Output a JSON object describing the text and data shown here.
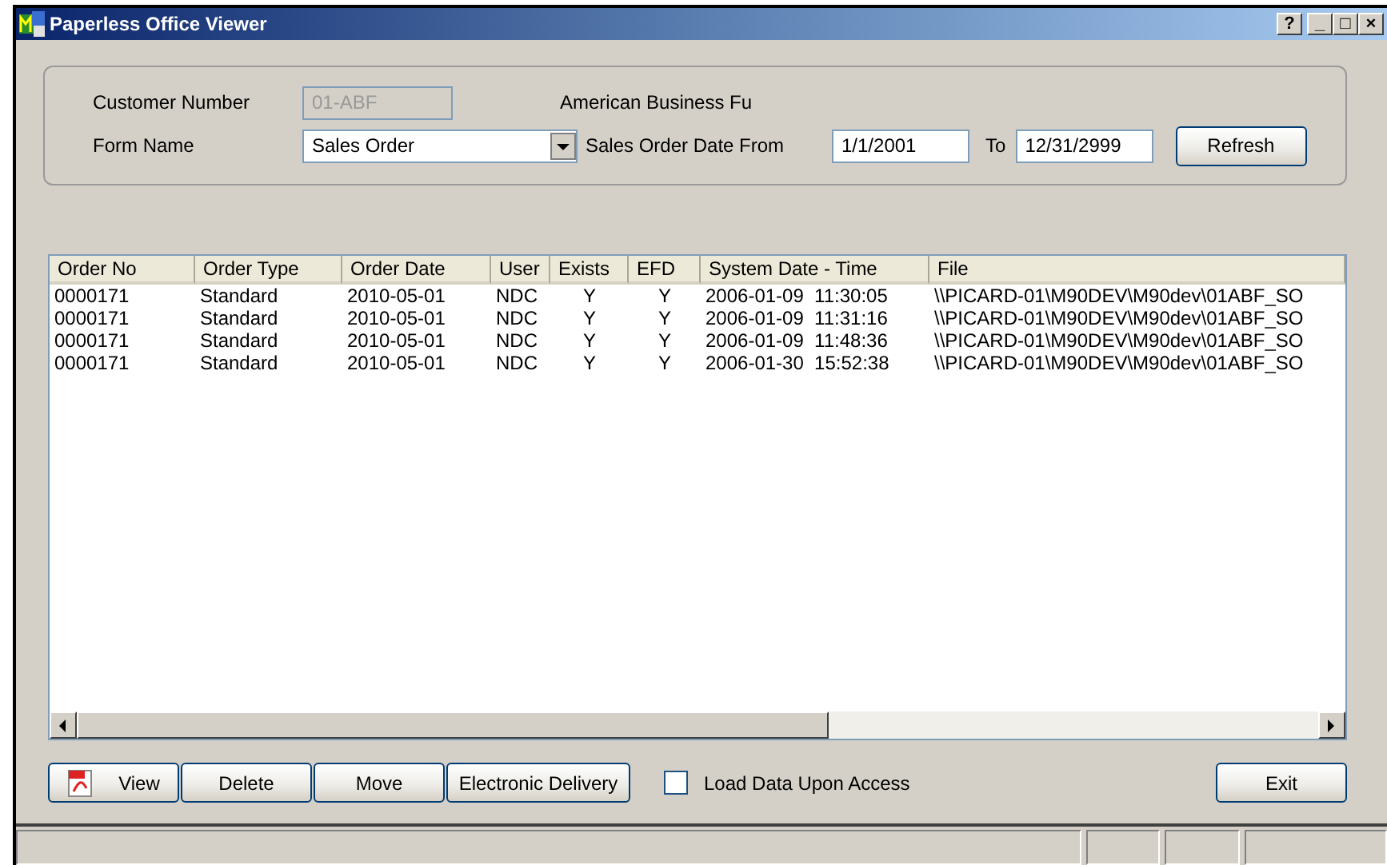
{
  "window": {
    "title": "Paperless Office Viewer",
    "title_buttons": [
      "?",
      "_",
      "□",
      "×"
    ]
  },
  "filters": {
    "customer_number": {
      "label": "Customer Number",
      "value": "01-ABF",
      "disabled": true
    },
    "customer_name": "American Business Fu",
    "form_name": {
      "label": "Form Name",
      "value": "Sales Order"
    },
    "date_from": {
      "label": "Sales Order Date From",
      "value": "1/1/2001"
    },
    "date_to": {
      "label": "To",
      "value": "12/31/2999"
    },
    "refresh_button": "Refresh"
  },
  "table": {
    "columns": [
      "Order No",
      "Order Type",
      "Order Date",
      "User",
      "Exists",
      "EFD",
      "System Date - Time",
      "File"
    ],
    "rows": [
      [
        "0000171",
        "Standard",
        "2010-05-01",
        "NDC",
        "Y",
        "Y",
        "2006-01-09  11:30:05",
        "\\\\PICARD-01\\M90DEV\\M90dev\\01ABF_SO"
      ],
      [
        "0000171",
        "Standard",
        "2010-05-01",
        "NDC",
        "Y",
        "Y",
        "2006-01-09  11:31:16",
        "\\\\PICARD-01\\M90DEV\\M90dev\\01ABF_SO"
      ],
      [
        "0000171",
        "Standard",
        "2010-05-01",
        "NDC",
        "Y",
        "Y",
        "2006-01-09  11:48:36",
        "\\\\PICARD-01\\M90DEV\\M90dev\\01ABF_SO"
      ],
      [
        "0000171",
        "Standard",
        "2010-05-01",
        "NDC",
        "Y",
        "Y",
        "2006-01-30  15:52:38",
        "\\\\PICARD-01\\M90DEV\\M90dev\\01ABF_SO"
      ]
    ]
  },
  "actions": [
    {
      "label": "View",
      "kind": "pdf"
    },
    {
      "label": "Delete",
      "kind": "plain"
    },
    {
      "label": "Move",
      "kind": "plain"
    },
    {
      "label": "Electronic Delivery",
      "kind": "plain"
    }
  ],
  "load_data_upon_access": {
    "label": "Load Data Upon Access",
    "checked": false
  },
  "exit_button": "Exit"
}
